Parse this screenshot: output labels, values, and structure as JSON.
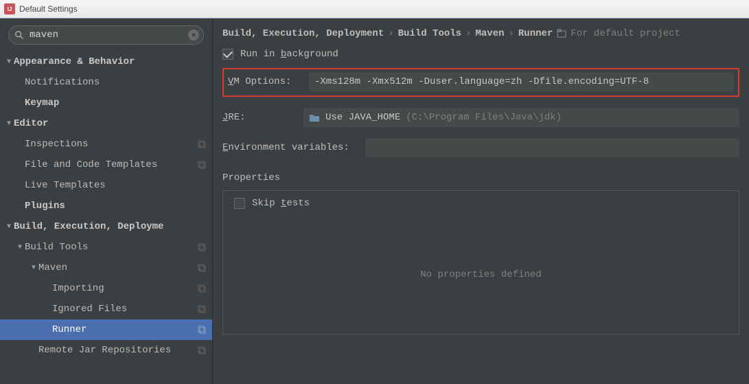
{
  "window": {
    "title": "Default Settings"
  },
  "search": {
    "value": "maven"
  },
  "tree": {
    "appearance": "Appearance & Behavior",
    "notifications": "Notifications",
    "keymap": "Keymap",
    "editor": "Editor",
    "inspections": "Inspections",
    "file_templates": "File and Code Templates",
    "live_templates": "Live Templates",
    "plugins": "Plugins",
    "build_exec": "Build, Execution, Deployme",
    "build_tools": "Build Tools",
    "maven": "Maven",
    "importing": "Importing",
    "ignored": "Ignored Files",
    "runner": "Runner",
    "remote_jar": "Remote Jar Repositories"
  },
  "breadcrumb": {
    "a": "Build, Execution, Deployment",
    "b": "Build Tools",
    "c": "Maven",
    "d": "Runner",
    "hint": "For default project"
  },
  "form": {
    "run_bg_label_pre": "Run in ",
    "run_bg_label_mn": "b",
    "run_bg_label_post": "ackground",
    "run_bg_checked": true,
    "vm_label_mn": "V",
    "vm_label_post": "M Options:",
    "vm_value": "-Xms128m -Xmx512m -Duser.language=zh -Dfile.encoding=UTF-8",
    "jre_label_mn": "J",
    "jre_label_post": "RE:",
    "jre_text": "Use JAVA_HOME",
    "jre_hint": "(C:\\Program Files\\Java\\jdk)",
    "env_label_mn": "E",
    "env_label_post": "nvironment variables:",
    "env_value": "",
    "properties_title": "Properties",
    "skip_label_pre": "Skip ",
    "skip_label_mn": "t",
    "skip_label_post": "ests",
    "skip_checked": false,
    "no_props": "No properties defined"
  }
}
